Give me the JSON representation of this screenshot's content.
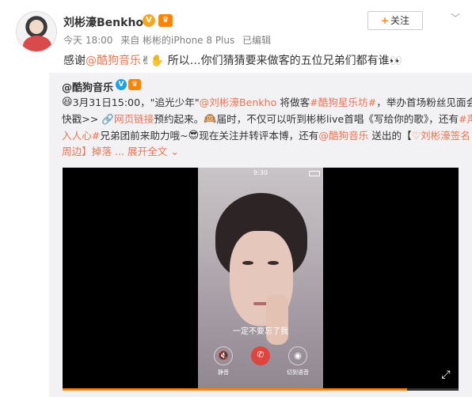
{
  "header": {
    "user_name": "刘彬濠Benkho",
    "verified_badge": "V",
    "crown_badge": "♛",
    "follow_label": "关注",
    "follow_plus": "+",
    "more_icon": "chevron-down-icon"
  },
  "meta": {
    "time": "今天 18:00",
    "source": "来自 彬彬的iPhone 8 Plus",
    "edited": "已编辑"
  },
  "post": {
    "prefix": "感谢",
    "mention": "@酷狗音乐",
    "suffix": "✌✋ 所以…你们猜猜要来做客的五位兄弟们都有谁",
    "emoji_end": "👀"
  },
  "repost": {
    "author": "@酷狗音乐",
    "v_badge": "V",
    "crown_badge": "♛",
    "line1": {
      "emoji": "😆",
      "date": "3月31日15:00，\"追光少年\"",
      "mention": "@刘彬濠Benkho",
      "mid": " 将做客",
      "topic": "#酷狗星乐坊#",
      "end": "，举办首场粉丝见面会，"
    },
    "line2": {
      "start": "快戳>> ",
      "link": "🔗网页链接",
      "mid": "预约起来。",
      "emoji": "🙉",
      "end": "届时，不仅可以听到彬彬live首唱《写给你的歌》，还有",
      "topic": "#声"
    },
    "line3": {
      "topic": "入人心#",
      "mid": "兄弟团前来助力哦~",
      "emoji": "😎",
      "end": "现在关注并转评本博，还有",
      "mention": "@酷狗音乐",
      "tail": " 送出的【",
      "gift": "♡刘彬濠",
      "gift_end": "签名"
    },
    "line4": {
      "start": "周边】掉落 ... ",
      "expand": "展开全文",
      "expand_icon": "chevron-down-icon"
    }
  },
  "video": {
    "status_time": "9:30",
    "caption": "一定不要忘了我",
    "btn_left_label": "静音",
    "btn_right_label": "切到语音",
    "hangup_icon": "phone-icon",
    "fullscreen_icon": "fullscreen-icon",
    "progress_fraction": 0.87,
    "accent": "#ff8200"
  },
  "colors": {
    "link": "#eb7350",
    "badge_orange": "#ff8200",
    "badge_blue": "#1aa1e6"
  }
}
